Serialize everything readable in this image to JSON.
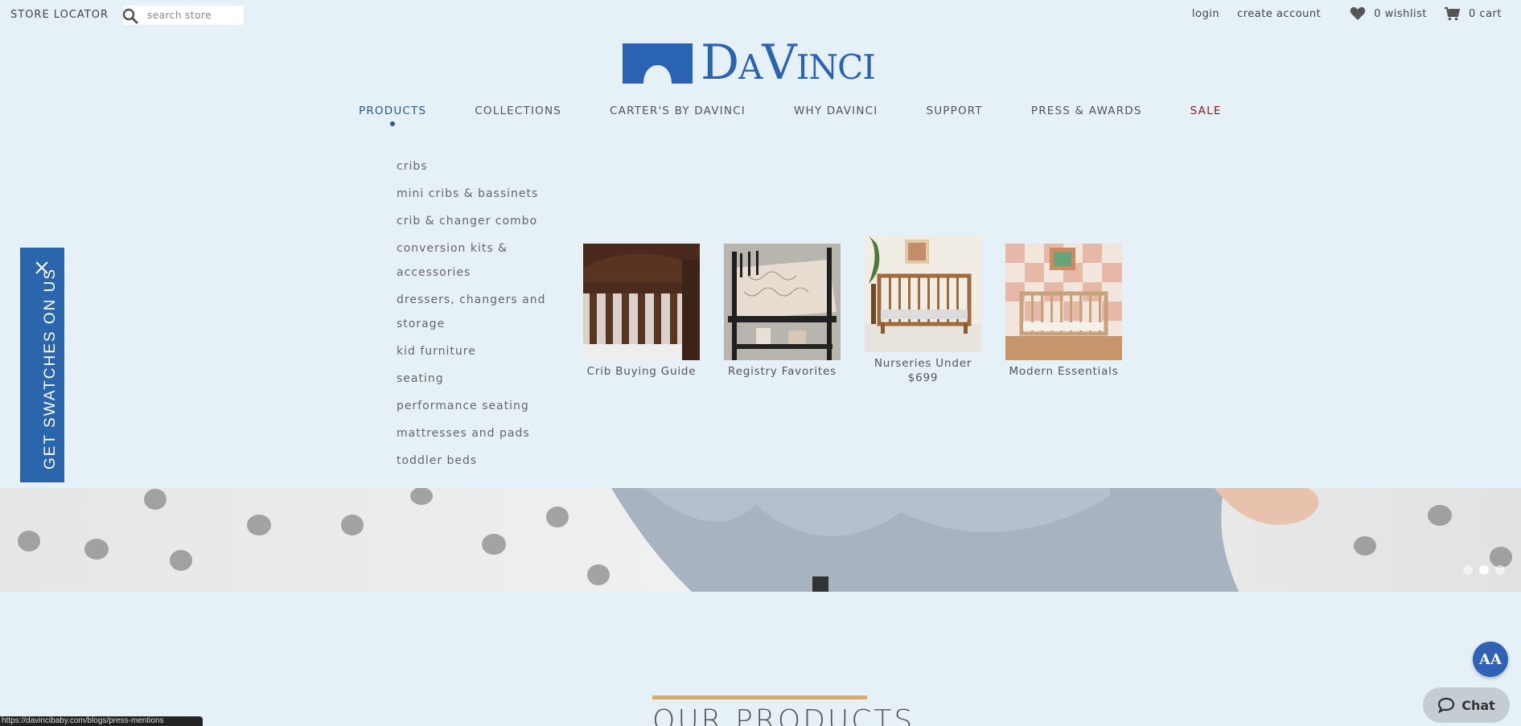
{
  "topbar": {
    "store_locator": "STORE LOCATOR",
    "search_placeholder": "search store",
    "login": "login",
    "create_account": "create account",
    "wishlist": "0 wishlist",
    "cart": "0 cart"
  },
  "logo": {
    "text": "DaVinci"
  },
  "nav": {
    "items": [
      {
        "label": "PRODUCTS"
      },
      {
        "label": "COLLECTIONS"
      },
      {
        "label": "CARTER'S BY DAVINCI"
      },
      {
        "label": "WHY DAVINCI"
      },
      {
        "label": "SUPPORT"
      },
      {
        "label": "PRESS & AWARDS"
      },
      {
        "label": "SALE"
      }
    ],
    "active": "PRODUCTS"
  },
  "submenu": {
    "items": [
      "cribs",
      "mini cribs & bassinets",
      "crib & changer combo",
      "conversion kits & accessories",
      "dressers, changers and storage",
      "kid furniture",
      "seating",
      "performance seating",
      "mattresses and pads",
      "toddler beds"
    ]
  },
  "cards": [
    {
      "caption": "Crib Buying Guide"
    },
    {
      "caption": "Registry Favorites"
    },
    {
      "caption": "Nurseries Under $699"
    },
    {
      "caption": "Modern Essentials"
    }
  ],
  "swatch_tab": {
    "label": "GET SWATCHES ON US"
  },
  "carousel": {
    "slide_count": 3,
    "active_slide": 2
  },
  "section": {
    "title": "OUR PRODUCTS"
  },
  "accessibility_button": {
    "label": "AA"
  },
  "chat": {
    "label": "Chat"
  },
  "status_bar": {
    "url": "https://davincibaby.com/blogs/press-mentions"
  },
  "colors": {
    "brand": "#2a63b1",
    "sale": "#8a1a1a",
    "accent": "#e7a85a",
    "background": "#e6f0f7"
  }
}
